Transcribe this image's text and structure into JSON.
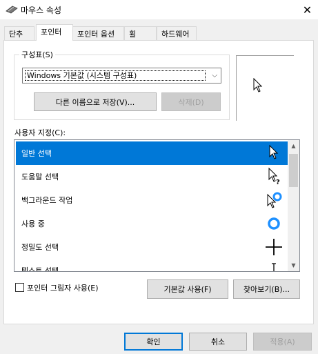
{
  "window": {
    "title": "마우스 속성"
  },
  "tabs": [
    {
      "label": "단추"
    },
    {
      "label": "포인터"
    },
    {
      "label": "포인터 옵션"
    },
    {
      "label": "휠"
    },
    {
      "label": "하드웨어"
    }
  ],
  "scheme": {
    "label": "구성표(S)",
    "selected": "Windows 기본값 (시스템 구성표)",
    "save_as_label": "다른 이름으로 저장(V)...",
    "delete_label": "삭제(D)"
  },
  "customize": {
    "label": "사용자 지정(C):",
    "items": [
      {
        "label": "일반 선택",
        "icon": "arrow-cursor-icon",
        "selected": true
      },
      {
        "label": "도움말 선택",
        "icon": "help-cursor-icon",
        "selected": false
      },
      {
        "label": "백그라운드 작업",
        "icon": "working-in-background-cursor-icon",
        "selected": false
      },
      {
        "label": "사용 중",
        "icon": "busy-cursor-icon",
        "selected": false
      },
      {
        "label": "정밀도 선택",
        "icon": "crosshair-cursor-icon",
        "selected": false
      },
      {
        "label": "텍스트 선택",
        "icon": "text-cursor-icon",
        "selected": false
      }
    ]
  },
  "options": {
    "shadow_label": "포인터 그림자 사용(E)",
    "shadow_checked": false,
    "default_label": "기본값 사용(F)",
    "browse_label": "찾아보기(B)..."
  },
  "footer": {
    "ok_label": "확인",
    "cancel_label": "취소",
    "apply_label": "적용(A)"
  },
  "colors": {
    "accent": "#0078d7"
  }
}
